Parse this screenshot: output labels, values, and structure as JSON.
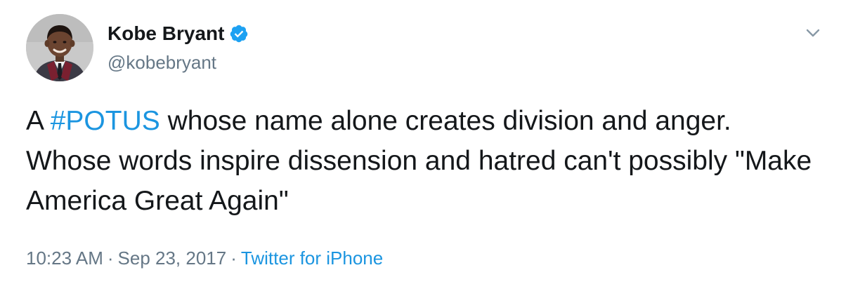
{
  "author": {
    "display_name": "Kobe Bryant",
    "handle": "@kobebryant",
    "verified": true,
    "avatar_icon": "profile-photo"
  },
  "tweet": {
    "text_before": "A ",
    "hashtag": "#POTUS",
    "text_after": " whose name alone creates division and anger. Whose words inspire dissension and hatred can't possibly \"Make America Great Again\""
  },
  "meta": {
    "time": "10:23 AM",
    "separator": "·",
    "date": "Sep 23, 2017",
    "source": "Twitter for iPhone"
  },
  "icons": {
    "verified": "verified-badge-icon",
    "menu": "chevron-down-icon"
  },
  "colors": {
    "text": "#14171a",
    "secondary": "#657786",
    "link": "#1b95e0",
    "verified": "#1da1f2",
    "background": "#ffffff"
  }
}
